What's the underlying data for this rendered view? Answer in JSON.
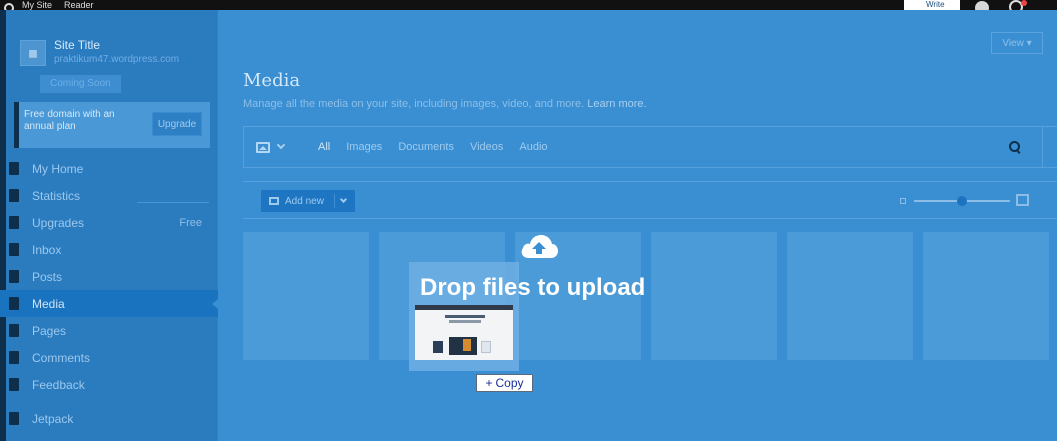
{
  "masterbar": {
    "site_menu": "My Site",
    "reader": "Reader",
    "write": "Write"
  },
  "sidebar": {
    "site_title": "Site Title",
    "site_url": "praktikum47.wordpress.com",
    "site_status": "Coming Soon",
    "promo_text": "Free domain with an annual plan",
    "promo_button": "Upgrade",
    "items": [
      {
        "label": "My Home",
        "icon": "house-icon"
      },
      {
        "label": "Statistics",
        "icon": "bar-chart-icon"
      },
      {
        "label": "Upgrades",
        "icon": "flag-icon",
        "count": "Free"
      },
      {
        "label": "Inbox",
        "icon": "mail-icon"
      },
      {
        "label": "Posts",
        "icon": "pin-icon"
      },
      {
        "label": "Media",
        "icon": "image-icon",
        "active": true
      },
      {
        "label": "Pages",
        "icon": "page-icon"
      },
      {
        "label": "Comments",
        "icon": "comment-icon"
      },
      {
        "label": "Feedback",
        "icon": "feedback-icon"
      },
      {
        "label": "Jetpack",
        "icon": "jetpack-icon"
      }
    ]
  },
  "header": {
    "view_button": "View ▾",
    "title": "Media",
    "subtitle": "Manage all the media on your site, including images, video, and more.",
    "learn_more": "Learn more."
  },
  "filters": {
    "tabs": [
      "All",
      "Images",
      "Documents",
      "Videos",
      "Audio"
    ],
    "active_tab": "All"
  },
  "toolbar": {
    "add_new": "Add new",
    "zoom_level": 0.5
  },
  "drop_overlay": {
    "title": "Drop files to upload",
    "copy_label": "Copy",
    "copy_symbol": "+"
  },
  "colors": {
    "overlay": "#3a8ed2",
    "sidebar": "#2b7bbf",
    "active_item": "#1a73bf"
  }
}
